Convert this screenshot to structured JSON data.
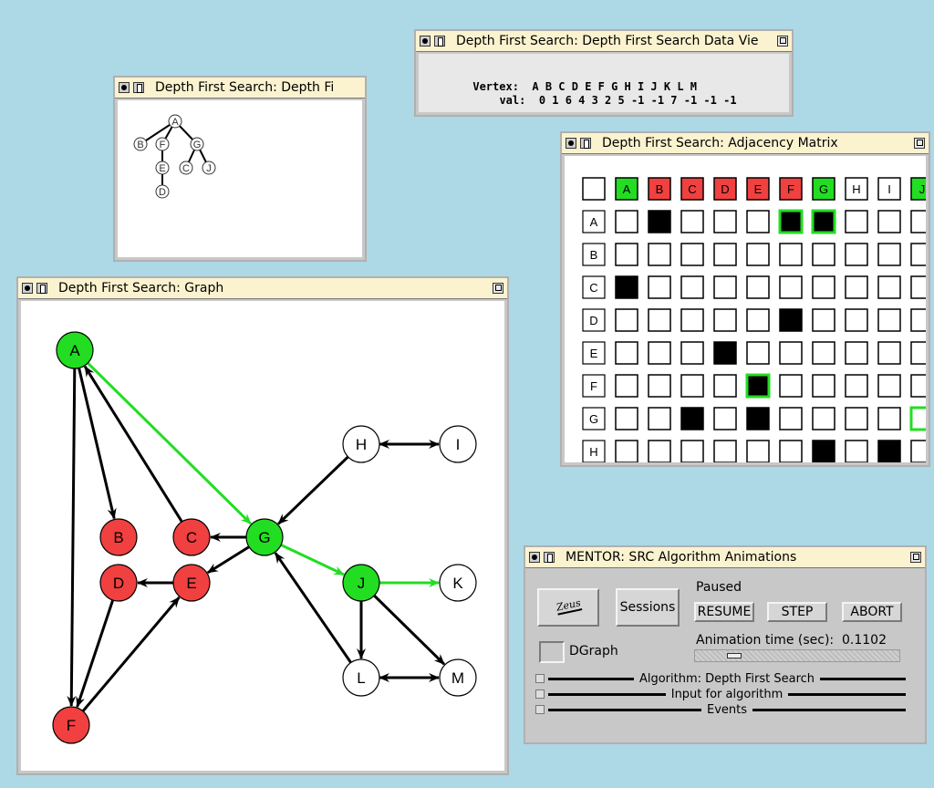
{
  "colors": {
    "desktop": "#add8e6",
    "visited_red": "#f04040",
    "active_green": "#22dd22",
    "title_bg": "#fbf3cf"
  },
  "tree_window": {
    "title": "Depth First Search: Depth Fi",
    "nodes": [
      "A",
      "B",
      "F",
      "G",
      "E",
      "C",
      "J",
      "D"
    ]
  },
  "data_view_window": {
    "title": "Depth First Search: Depth First Search Data Vie",
    "vertex_label": "Vertex:",
    "vertices": "A B C D E F G H I J K L M",
    "val_label": "val:",
    "values": "0 1 6 4 3 2 5 -1 -1 7 -1 -1 -1"
  },
  "matrix_window": {
    "title": "Depth First Search: Adjacency Matrix",
    "columns": [
      "A",
      "B",
      "C",
      "D",
      "E",
      "F",
      "G",
      "H",
      "I",
      "J"
    ],
    "column_states": [
      "green",
      "red",
      "red",
      "red",
      "red",
      "red",
      "green",
      "white",
      "white",
      "green"
    ],
    "rows": [
      "A",
      "B",
      "C",
      "D",
      "E",
      "F",
      "G",
      "H"
    ],
    "filled": [
      [
        0,
        1
      ],
      [
        0,
        5
      ],
      [
        0,
        6
      ],
      [
        2,
        0
      ],
      [
        3,
        5
      ],
      [
        4,
        3
      ],
      [
        5,
        4
      ],
      [
        6,
        2
      ],
      [
        6,
        4
      ],
      [
        7,
        6
      ],
      [
        7,
        8
      ]
    ],
    "highlighted": [
      [
        0,
        5
      ],
      [
        0,
        6
      ],
      [
        5,
        4
      ],
      [
        6,
        9
      ]
    ]
  },
  "graph_window": {
    "title": "Depth First Search: Graph",
    "nodes": {
      "A": {
        "label": "A",
        "state": "green"
      },
      "B": {
        "label": "B",
        "state": "red"
      },
      "C": {
        "label": "C",
        "state": "red"
      },
      "D": {
        "label": "D",
        "state": "red"
      },
      "E": {
        "label": "E",
        "state": "red"
      },
      "F": {
        "label": "F",
        "state": "red"
      },
      "G": {
        "label": "G",
        "state": "green"
      },
      "H": {
        "label": "H",
        "state": "white"
      },
      "I": {
        "label": "I",
        "state": "white"
      },
      "J": {
        "label": "J",
        "state": "green"
      },
      "K": {
        "label": "K",
        "state": "white"
      },
      "L": {
        "label": "L",
        "state": "white"
      },
      "M": {
        "label": "M",
        "state": "white"
      }
    },
    "edges": [
      {
        "from": "A",
        "to": "B",
        "color": "black"
      },
      {
        "from": "A",
        "to": "F",
        "color": "black"
      },
      {
        "from": "C",
        "to": "A",
        "color": "black"
      },
      {
        "from": "A",
        "to": "G",
        "color": "green"
      },
      {
        "from": "G",
        "to": "C",
        "color": "black"
      },
      {
        "from": "G",
        "to": "E",
        "color": "black"
      },
      {
        "from": "E",
        "to": "D",
        "color": "black"
      },
      {
        "from": "D",
        "to": "F",
        "color": "black"
      },
      {
        "from": "F",
        "to": "E",
        "color": "black"
      },
      {
        "from": "H",
        "to": "G",
        "color": "black"
      },
      {
        "from": "H",
        "to": "I",
        "color": "black",
        "both": true
      },
      {
        "from": "G",
        "to": "J",
        "color": "green"
      },
      {
        "from": "J",
        "to": "K",
        "color": "green"
      },
      {
        "from": "J",
        "to": "L",
        "color": "black"
      },
      {
        "from": "J",
        "to": "M",
        "color": "black"
      },
      {
        "from": "L",
        "to": "M",
        "color": "black",
        "both": true
      },
      {
        "from": "L",
        "to": "G",
        "color": "black"
      }
    ]
  },
  "control_window": {
    "title": "MENTOR: SRC Algorithm Animations",
    "zeus_label": "Zeus",
    "sessions_label": "Sessions",
    "status": "Paused",
    "resume_label": "RESUME",
    "step_label": "STEP",
    "abort_label": "ABORT",
    "anim_time_label": "Animation time (sec):",
    "anim_time_value": "0.1102",
    "anim_time_fraction": 0.05,
    "dgraph_label": "DGraph",
    "algorithm_label": "Algorithm:  Depth First Search",
    "input_label": "Input for algorithm",
    "events_label": "Events"
  }
}
